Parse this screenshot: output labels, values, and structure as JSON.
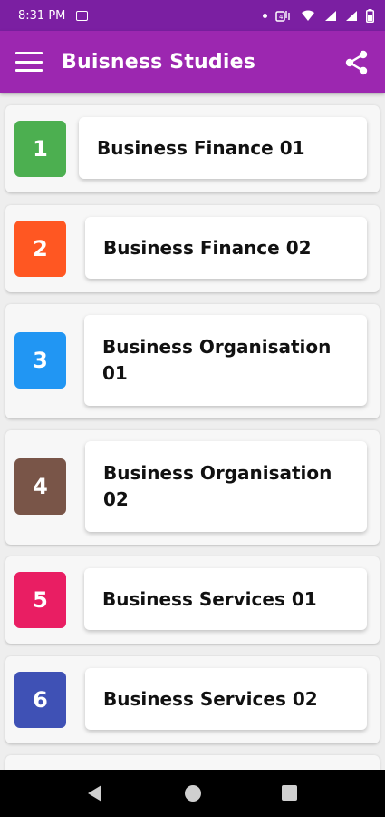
{
  "status_bar": {
    "time": "8:31 PM",
    "icons": [
      "image-icon",
      "notification-dot-icon",
      "volte-icon",
      "wifi-icon",
      "signal-icon",
      "signal-icon",
      "battery-icon"
    ]
  },
  "app_bar": {
    "title": "Buisness Studies",
    "menu_icon": "menu-icon",
    "share_icon": "share-icon",
    "color": "#9c27b0"
  },
  "chapters": [
    {
      "number": "1",
      "title": "Business Finance 01",
      "color": "#4caf50"
    },
    {
      "number": "2",
      "title": "Business Finance 02",
      "color": "#ff5722"
    },
    {
      "number": "3",
      "title": "Business Organisation 01",
      "color": "#2196f3"
    },
    {
      "number": "4",
      "title": "Business Organisation 02",
      "color": "#795548"
    },
    {
      "number": "5",
      "title": "Business Services 01",
      "color": "#e91e63"
    },
    {
      "number": "6",
      "title": "Business Services 02",
      "color": "#3f51b5"
    }
  ],
  "nav_bar": {
    "icons": [
      "back-icon",
      "home-icon",
      "recents-icon"
    ]
  }
}
